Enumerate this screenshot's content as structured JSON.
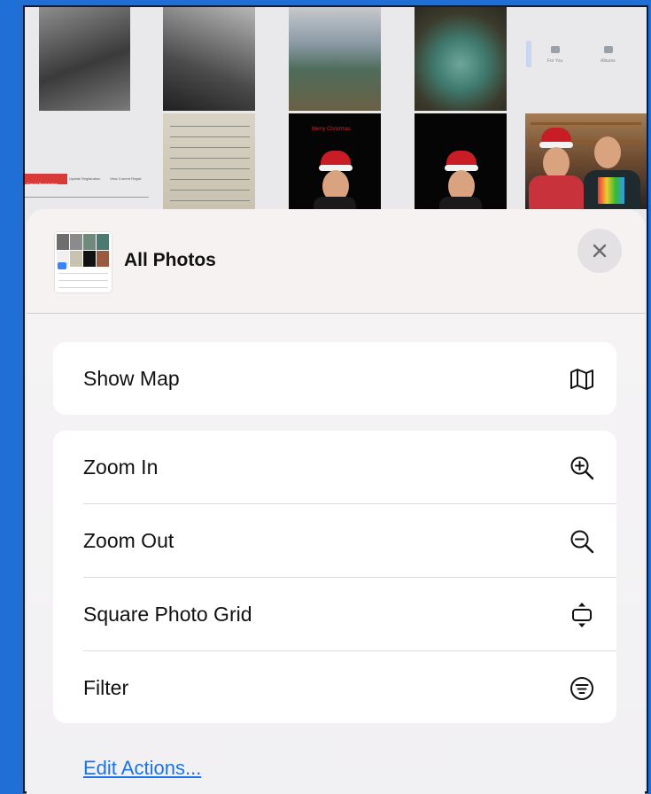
{
  "sheet": {
    "title": "All Photos",
    "close_label": "Close"
  },
  "groups": [
    {
      "items": [
        {
          "label": "Show Map",
          "icon": "map-icon"
        }
      ]
    },
    {
      "items": [
        {
          "label": "Zoom In",
          "icon": "zoom-in-icon"
        },
        {
          "label": "Zoom Out",
          "icon": "zoom-out-icon"
        },
        {
          "label": "Square Photo Grid",
          "icon": "aspect-grid-icon"
        },
        {
          "label": "Filter",
          "icon": "filter-icon"
        }
      ]
    }
  ],
  "footer": {
    "edit_actions_label": "Edit Actions..."
  },
  "background": {
    "tab_for_you": "For You",
    "tab_albums": "Albums",
    "mini_button_1": "Cancel Registration",
    "mini_button_2": "Update Registration",
    "mini_button_3": "View Current Regist",
    "photo_caption": "Merry Christmas"
  },
  "colors": {
    "desktop": "#1f6fd6",
    "link": "#1a73e8",
    "sheet": "#f6f4f4"
  }
}
